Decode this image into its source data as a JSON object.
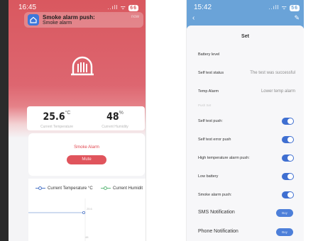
{
  "left_app": {
    "status_time": "16:45",
    "status_icons": "..ıll ᯤ",
    "battery": "66",
    "notification": {
      "title": "Smoke alarm push:",
      "body": "Smoke alarm",
      "time": "now"
    },
    "readings": {
      "temperature": {
        "value": "25.6",
        "unit": "°C",
        "label": "Current Temperature"
      },
      "humidity": {
        "value": "48",
        "unit": "%",
        "label": "Current Humidity"
      }
    },
    "alarm": {
      "title": "Smoke Alarm",
      "button": "Mute"
    },
    "chart_legend": {
      "temperature": "Current Temperature °C",
      "humidity": "Current Humidit"
    },
    "chart_data": {
      "type": "line",
      "series": [
        {
          "name": "Current Temperature °C",
          "values": [
            25.6
          ]
        }
      ],
      "data_labels": [
        "25.6",
        "48"
      ]
    },
    "colors": {
      "brand_red": "#d9585f",
      "mute_button": "#e0545c",
      "temp_series": "#4f78c8",
      "humidity_series": "#5fb87a"
    }
  },
  "right_app": {
    "status_time": "15:42",
    "status_icons": "..ıll ᯤ",
    "battery": "56",
    "back_icon": "chevron-left-icon",
    "edit_icon": "pencil-icon",
    "title": "Set",
    "rows": [
      {
        "label": "Battery level",
        "value": ""
      },
      {
        "label": "Self test status",
        "value": "The test was successful"
      },
      {
        "label": "Temp Alarm",
        "value": "Lower temp alarm"
      }
    ],
    "section_hint": "Push Set",
    "toggles": [
      {
        "label": "Self test push:",
        "on": true
      },
      {
        "label": "Self test error push",
        "on": true
      },
      {
        "label": "High temperature alarm push:",
        "on": true
      },
      {
        "label": "Low battery",
        "on": true
      },
      {
        "label": "Smoke alarm push:",
        "on": true
      }
    ],
    "notifications": [
      {
        "label": "SMS Notification",
        "button": "Buy"
      },
      {
        "label": "Phone Notification",
        "button": "Buy"
      }
    ],
    "colors": {
      "header_blue": "#6aa3d8",
      "toggle_on": "#3f6fd1",
      "buy_button": "#4d7fd9"
    }
  }
}
